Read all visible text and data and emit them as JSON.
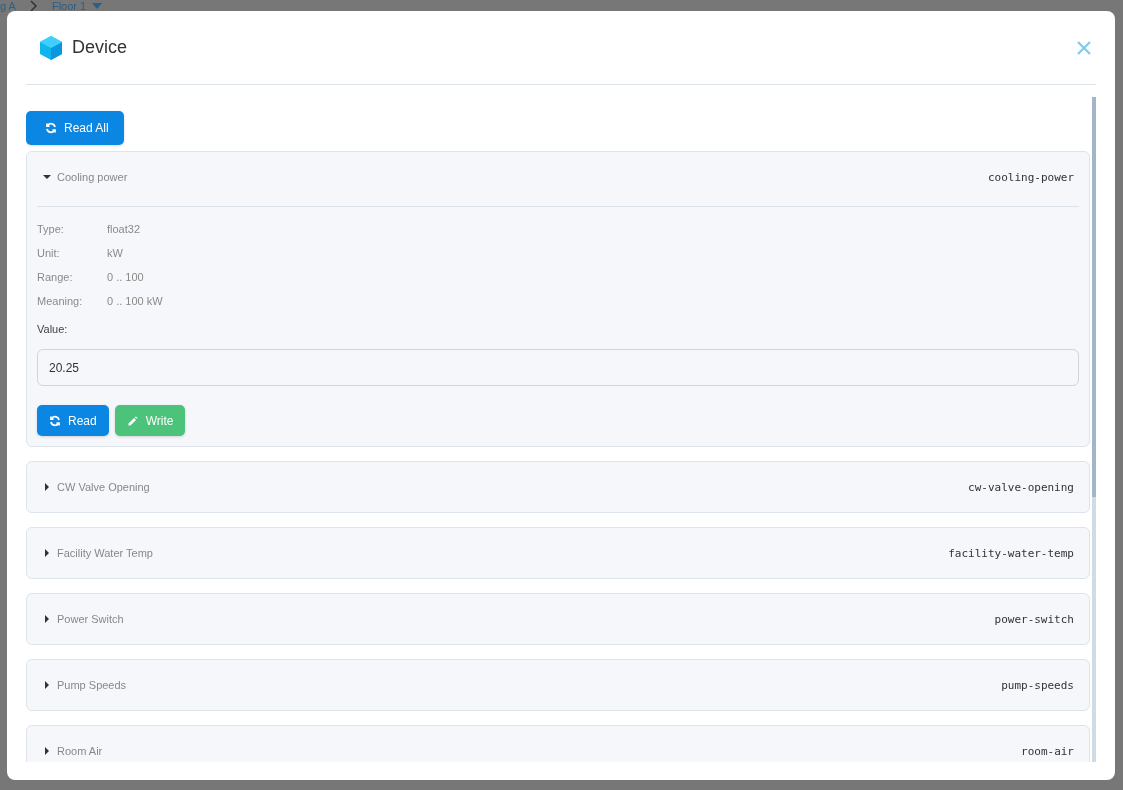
{
  "background": {
    "breadcrumb": [
      {
        "label": "g A",
        "dropdown": false
      },
      {
        "label": "Floor 1",
        "dropdown": true
      }
    ]
  },
  "dialog": {
    "title": "Device",
    "read_all_button": "Read All",
    "points": [
      {
        "name": "Cooling power",
        "id": "cooling-power",
        "expanded": true,
        "details": [
          {
            "label": "Type:",
            "value": "float32"
          },
          {
            "label": "Unit:",
            "value": "kW"
          },
          {
            "label": "Range:",
            "value": "0 .. 100"
          },
          {
            "label": "Meaning:",
            "value": "0 .. 100 kW"
          }
        ],
        "value_label": "Value:",
        "value": "20.25",
        "buttons": [
          {
            "label": "Read",
            "kind": "read"
          },
          {
            "label": "Write",
            "kind": "write"
          }
        ]
      },
      {
        "name": "CW Valve Opening",
        "id": "cw-valve-opening",
        "expanded": false
      },
      {
        "name": "Facility Water Temp",
        "id": "facility-water-temp",
        "expanded": false
      },
      {
        "name": "Power Switch",
        "id": "power-switch",
        "expanded": false
      },
      {
        "name": "Pump Speeds",
        "id": "pump-speeds",
        "expanded": false
      },
      {
        "name": "Room Air",
        "id": "room-air",
        "expanded": false
      }
    ]
  }
}
